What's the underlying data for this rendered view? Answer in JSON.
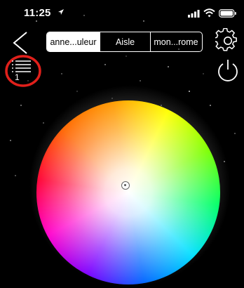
{
  "status_bar": {
    "time": "11:25",
    "icons": [
      "location-arrow-icon",
      "cellular-signal-icon",
      "wifi-icon",
      "battery-icon"
    ]
  },
  "header": {
    "back_icon": "chevron-left-icon",
    "segments": [
      {
        "label": "anne...uleur",
        "selected": true
      },
      {
        "label": "Aisle",
        "selected": false
      },
      {
        "label": "mon...rome",
        "selected": false
      }
    ],
    "settings_icon": "gear-icon",
    "power_icon": "power-icon"
  },
  "list_control": {
    "icon": "list-icon",
    "count": "1",
    "highlight_color": "#e0201b"
  },
  "color_wheel": {
    "icon": "color-picker-marker"
  },
  "colors": {
    "background": "#000000",
    "foreground": "#ffffff",
    "annotation_red": "#e0201b"
  }
}
